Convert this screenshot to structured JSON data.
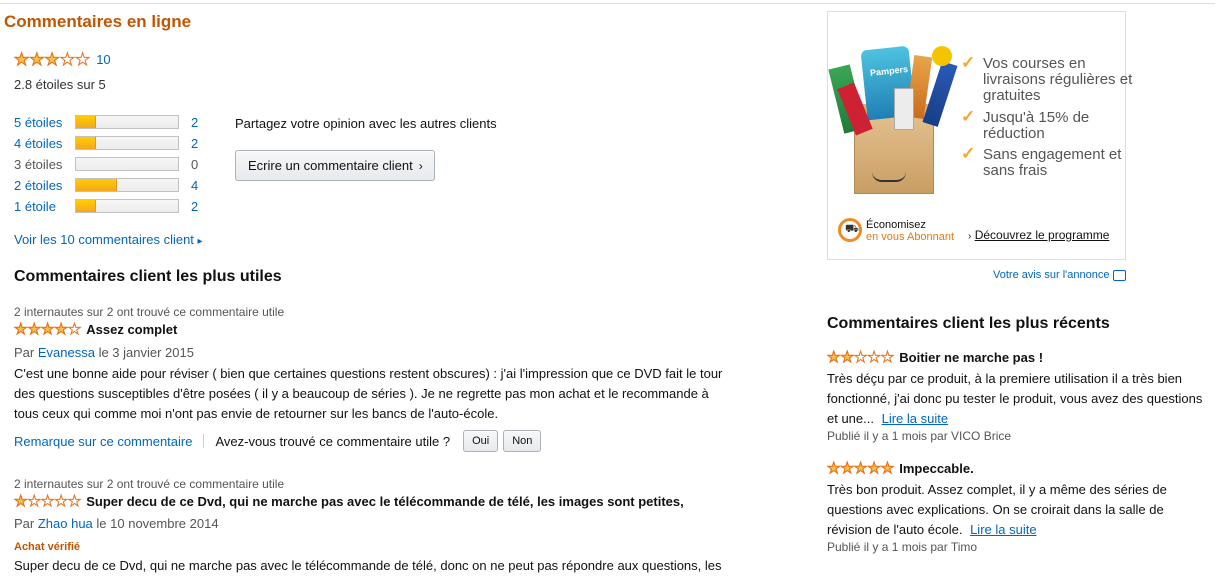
{
  "section_title": "Commentaires en ligne",
  "summary": {
    "stars_fraction": 0.56,
    "review_count": "10",
    "average_text": "2.8 étoiles sur 5"
  },
  "histogram": [
    {
      "label": "5 étoiles",
      "count": "2",
      "percent": 20,
      "linked": true
    },
    {
      "label": "4 étoiles",
      "count": "2",
      "percent": 20,
      "linked": true
    },
    {
      "label": "3 étoiles",
      "count": "0",
      "percent": 0,
      "linked": false
    },
    {
      "label": "2 étoiles",
      "count": "4",
      "percent": 40,
      "linked": true
    },
    {
      "label": "1 étoile",
      "count": "2",
      "percent": 20,
      "linked": true
    }
  ],
  "share_text": "Partagez votre opinion avec les autres clients",
  "write_review_button": "Ecrire un commentaire client",
  "see_all_link": "Voir les 10 commentaires client",
  "most_useful_title": "Commentaires client les plus utiles",
  "useful_reviews": [
    {
      "helpful": "2 internautes sur 2 ont trouvé ce commentaire utile",
      "stars_fraction": 0.8,
      "title": "Assez complet",
      "by_prefix": "Par",
      "author": "Evanessa",
      "date": "le 3 janvier 2015",
      "body": "C'est une bonne aide pour réviser ( bien que certaines questions restent obscures) : j'ai l'impression que ce DVD fait le tour des questions susceptibles d'être posées ( il y a beaucoup de séries ). Je ne regrette pas mon achat et le recommande à tous ceux qui comme moi n'ont pas envie de retourner sur les bancs de l'auto-école.",
      "comment_link": "Remarque sur ce commentaire",
      "useful_question": "Avez-vous trouvé ce commentaire utile ?",
      "yes": "Oui",
      "no": "Non"
    },
    {
      "helpful": "2 internautes sur 2 ont trouvé ce commentaire utile",
      "stars_fraction": 0.2,
      "title": "Super decu de ce Dvd, qui ne marche pas avec le télécommande de télé, les images sont petites,",
      "by_prefix": "Par",
      "author": "Zhao hua",
      "date": "le 10 novembre 2014",
      "verified": "Achat vérifié",
      "body": "Super decu de ce Dvd, qui ne marche pas avec le télécommande de télé, donc on ne peut pas répondre aux questions, les"
    }
  ],
  "ad": {
    "items": [
      "Vos courses en livraisons régulières et gratuites",
      "Jusqu'à 15% de réduction",
      "Sans engagement et sans frais"
    ],
    "save_line1": "Économisez",
    "save_line2": "en vous Abonnant",
    "discover": "Découvrez le programme",
    "box_brand": "Pampers",
    "feedback": "Votre avis sur l'annonce"
  },
  "recent_title": "Commentaires client les plus récents",
  "recent_reviews": [
    {
      "stars_fraction": 0.4,
      "title": "Boitier ne marche pas !",
      "body": "Très déçu par ce produit, à la premiere utilisation il a très bien fonctionné, j'ai donc pu tester le produit, vous avez des questions et une...",
      "read_more": "Lire la suite",
      "meta": "Publié il y a 1 mois par VICO Brice"
    },
    {
      "stars_fraction": 1.0,
      "title": "Impeccable.",
      "body": "Très bon produit. Assez complet, il y a même des séries de questions avec explications. On se croirait dans la salle de révision de l'auto école.",
      "read_more": "Lire la suite",
      "meta": "Publié il y a 1 mois par Timo"
    }
  ],
  "colors": {
    "accent": "#c45500",
    "link": "#0066c0",
    "star": "#f0c14b",
    "bar": "#f5a620"
  }
}
